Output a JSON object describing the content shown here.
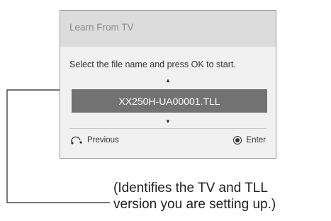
{
  "dialog": {
    "title": "Learn From TV",
    "instruction": "Select the file name and press OK to start.",
    "up_arrow": "▲",
    "down_arrow": "▼",
    "file_name": "XX250H-UA00001.TLL",
    "previous_label": "Previous",
    "enter_label": "Enter"
  },
  "caption": {
    "line1": "(Identifies the TV and TLL",
    "line2": "version you are setting up.)"
  }
}
